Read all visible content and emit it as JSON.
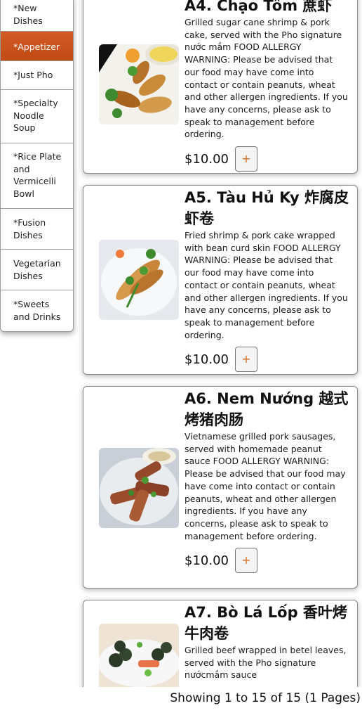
{
  "sidebar": {
    "items": [
      {
        "label": "*New Dishes",
        "active": false
      },
      {
        "label": "*Appetizer",
        "active": true
      },
      {
        "label": "*Just Pho",
        "active": false
      },
      {
        "label": "*Specialty Noodle Soup",
        "active": false
      },
      {
        "label": "*Rice Plate and Vermicelli Bowl",
        "active": false
      },
      {
        "label": "*Fusion Dishes",
        "active": false
      },
      {
        "label": "Vegetarian Dishes",
        "active": false
      },
      {
        "label": "*Sweets and Drinks",
        "active": false
      }
    ],
    "active_color": "#c8501a"
  },
  "menu_items": [
    {
      "title": "A4. Chạo Tôm 蔗虾",
      "description": "Grilled sugar cane shrimp & pork cake, served with the Pho signature nước mắm FOOD ALLERGY WARNING: Please be advised that our food may have come into contact or contain peanuts, wheat and other allergen ingredients. If you have any concerns, please ask to speak to management before ordering.",
      "price": "$10.00",
      "add_label": "+"
    },
    {
      "title": "A5. Tàu Hủ Ky 炸腐皮虾卷",
      "description": "Fried shrimp & pork cake wrapped with bean curd skin FOOD ALLERGY WARNING: Please be advised that our food may have come into contact or contain peanuts, wheat and other allergen ingredients. If you have any concerns, please ask to speak to management before ordering.",
      "price": "$10.00",
      "add_label": "+"
    },
    {
      "title": "A6. Nem Nướng 越式烤猪肉肠",
      "description": "Vietnamese grilled pork sausages, served with homemade peanut sauce FOOD ALLERGY WARNING: Please be advised that our food may have come into contact or contain peanuts, wheat and other allergen ingredients. If you have any concerns, please ask to speak to management before ordering.",
      "price": "$10.00",
      "add_label": "+"
    },
    {
      "title": "A7. Bò Lá Lốp 香叶烤牛肉卷",
      "description": "Grilled beef wrapped in betel leaves, served with the Pho signature nướcmắm sauce",
      "price": "",
      "add_label": "+"
    }
  ],
  "pagination": {
    "text": "Showing 1 to 15 of 15 (1 Pages)"
  },
  "colors": {
    "accent": "#c8501a",
    "add_button_plus": "#d2691e"
  }
}
